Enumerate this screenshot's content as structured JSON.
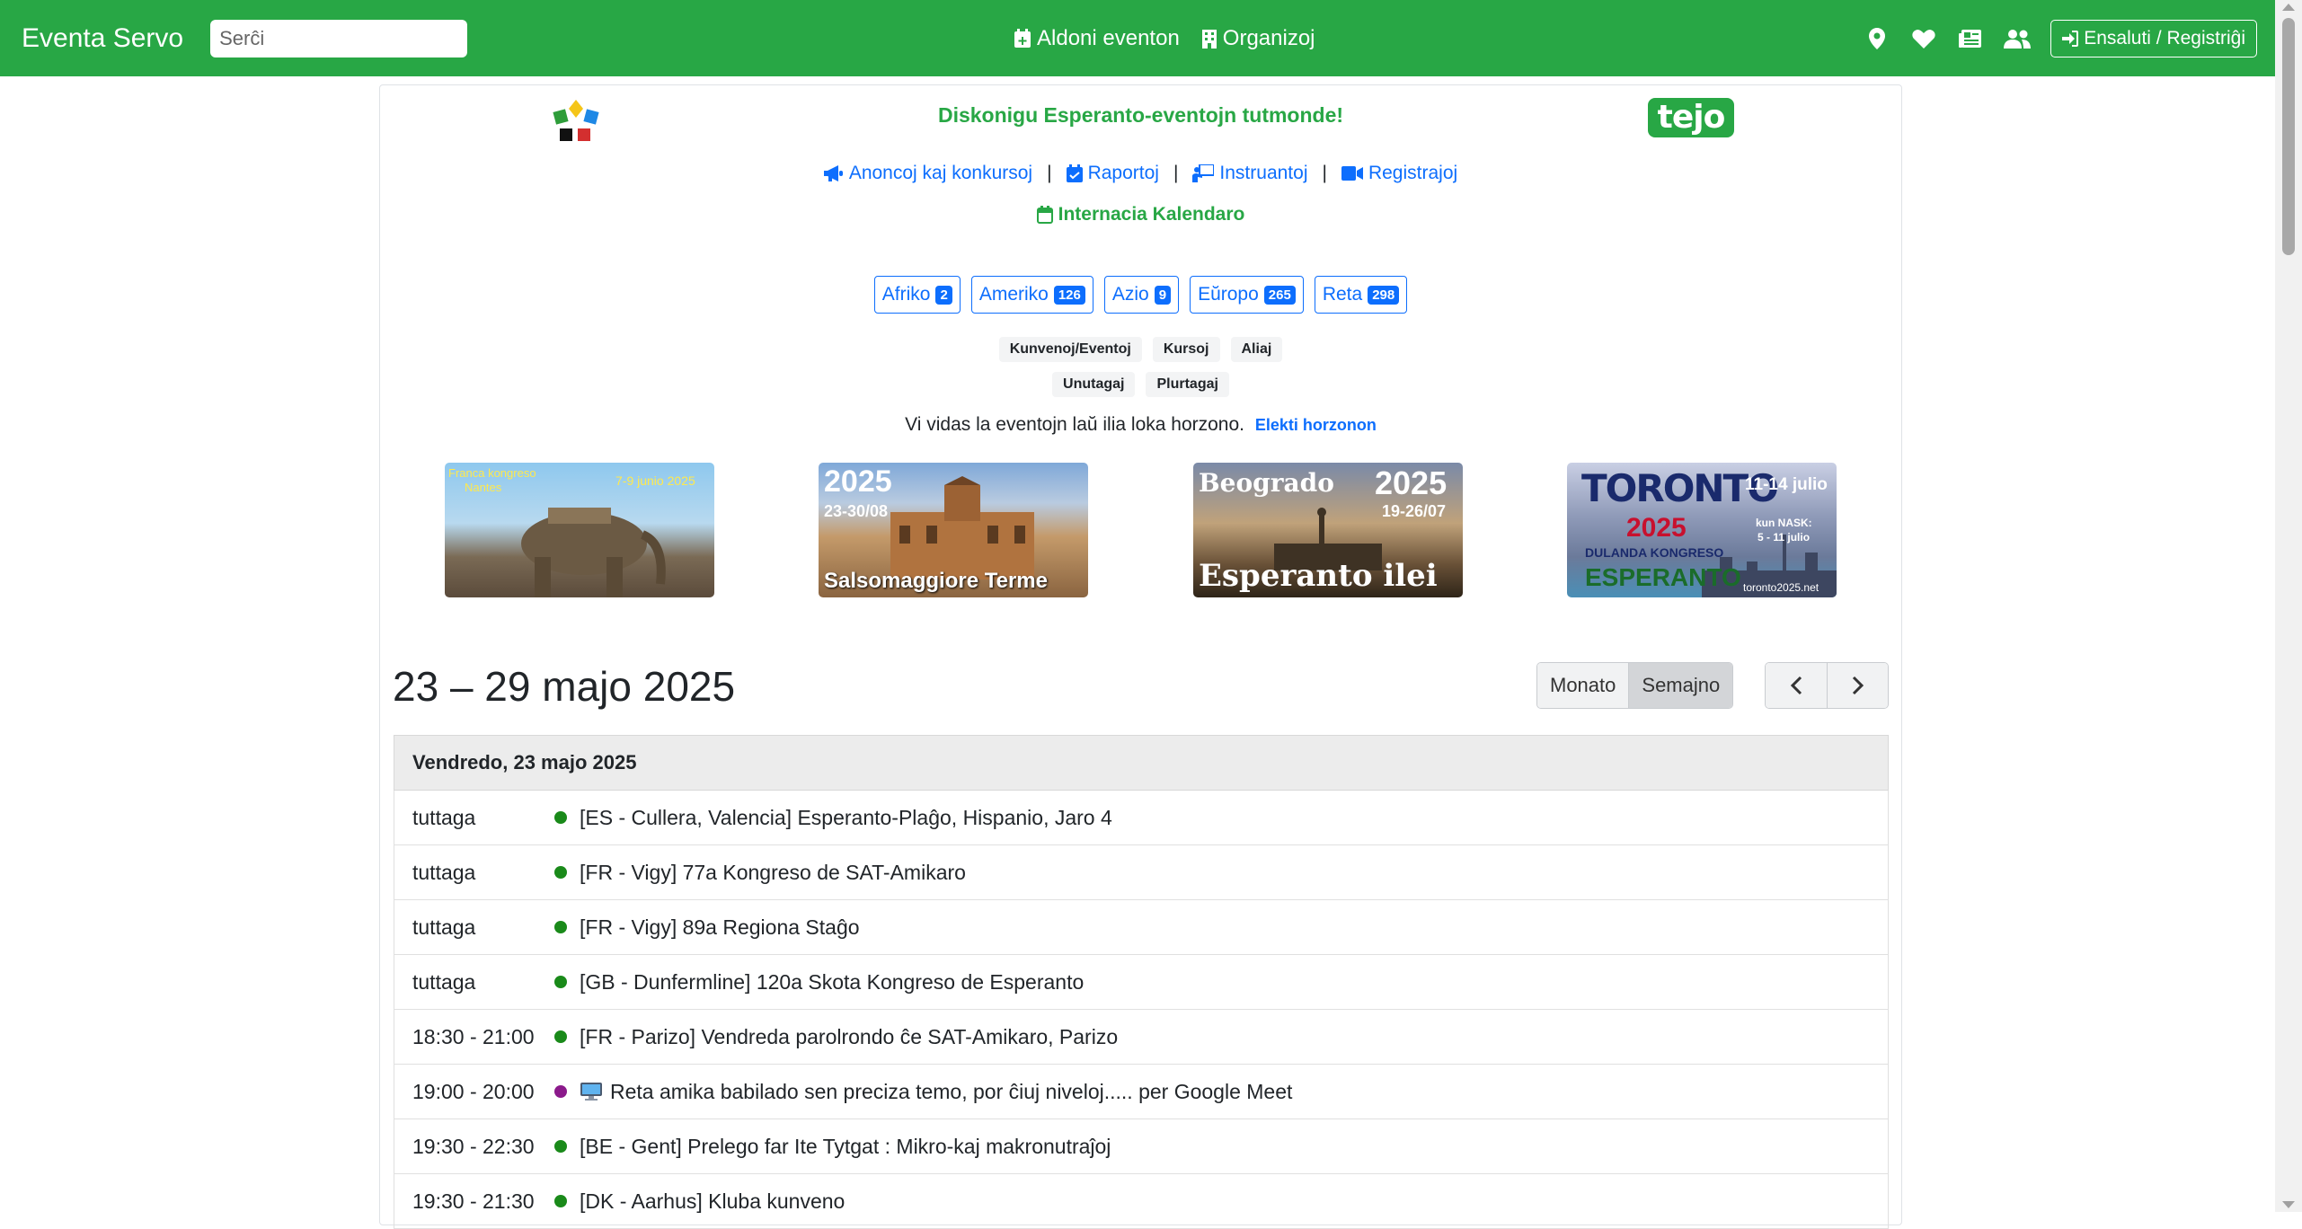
{
  "navbar": {
    "brand": "Eventa Servo",
    "search_placeholder": "Serĉi",
    "add_event": "Aldoni eventon",
    "organize": "Organizoj",
    "login": "Ensaluti / Registriĝi"
  },
  "header": {
    "tagline": "Diskonigu Esperanto-eventojn tutmonde!",
    "tejo_logo": "tejo",
    "links": [
      "Anoncoj kaj konkursoj",
      "Raportoj",
      "Instruantoj",
      "Registrajoj"
    ],
    "calendar": "Internacia Kalendaro"
  },
  "regions": [
    {
      "label": "Afriko",
      "count": "2"
    },
    {
      "label": "Ameriko",
      "count": "126"
    },
    {
      "label": "Azio",
      "count": "9"
    },
    {
      "label": "Eŭropo",
      "count": "265"
    },
    {
      "label": "Reta",
      "count": "298"
    }
  ],
  "tags": {
    "row1": [
      "Kunvenoj/Eventoj",
      "Kursoj",
      "Aliaj"
    ],
    "row2": [
      "Unutagaj",
      "Plurtagaj"
    ]
  },
  "horizon": {
    "text": "Vi vidas la eventojn laŭ ilia loka horzono.",
    "link": "Elekti horzonon"
  },
  "banners": [
    {
      "line1": "Franca kongreso",
      "line2": "Nantes",
      "dates": "7-9 junio 2025"
    },
    {
      "year": "2025",
      "dates": "23-30/08",
      "place": "Salsomaggiore Terme"
    },
    {
      "city": "Beogrado",
      "year": "2025",
      "dates": "19-26/07",
      "title": "Esperanto ilei"
    },
    {
      "city": "TORONTO",
      "year": "2025",
      "dates": "11-14 julio",
      "nask": "kun NASK:",
      "nask_dates": "5 - 11 julio",
      "sub": "DULANDA KONGRESO",
      "word": "ESPERANTO",
      "url": "toronto2025.net"
    }
  ],
  "calendar": {
    "week_title": "23 – 29 majo 2025",
    "views": [
      "Monato",
      "Semajno"
    ],
    "active_view": "Semajno",
    "day_header": "Vendredo, 23 majo 2025",
    "events": [
      {
        "time": "tuttaga",
        "color": "#1a8a1a",
        "title": "[ES - Cullera, Valencia] Esperanto-Plaĝo, Hispanio, Jaro 4"
      },
      {
        "time": "tuttaga",
        "color": "#1a8a1a",
        "title": "[FR - Vigy] 77a Kongreso de SAT-Amikaro"
      },
      {
        "time": "tuttaga",
        "color": "#1a8a1a",
        "title": "[FR - Vigy] 89a Regiona Staĝo"
      },
      {
        "time": "tuttaga",
        "color": "#1a8a1a",
        "title": "[GB - Dunfermline] 120a Skota Kongreso de Esperanto"
      },
      {
        "time": "18:30 - 21:00",
        "color": "#1a8a1a",
        "title": "[FR - Parizo] Vendreda parolrondo ĉe SAT-Amikaro, Parizo"
      },
      {
        "time": "19:00 - 20:00",
        "color": "#8b1a8b",
        "title": "Reta amika babilado sen preciza temo, por ĉiuj niveloj..... per Google Meet",
        "icon": "computer-icon"
      },
      {
        "time": "19:30 - 22:30",
        "color": "#1a8a1a",
        "title": "[BE - Gent] Prelego far Ite Tytgat : Mikro-kaj makronutraĵoj"
      },
      {
        "time": "19:30 - 21:30",
        "color": "#1a8a1a",
        "title": "[DK - Aarhus] Kluba kunveno"
      }
    ]
  },
  "colors": {
    "navbar": "#28a745",
    "link": "#0d6efd",
    "physical_event": "#1a8a1a",
    "online_event": "#8b1a8b"
  }
}
